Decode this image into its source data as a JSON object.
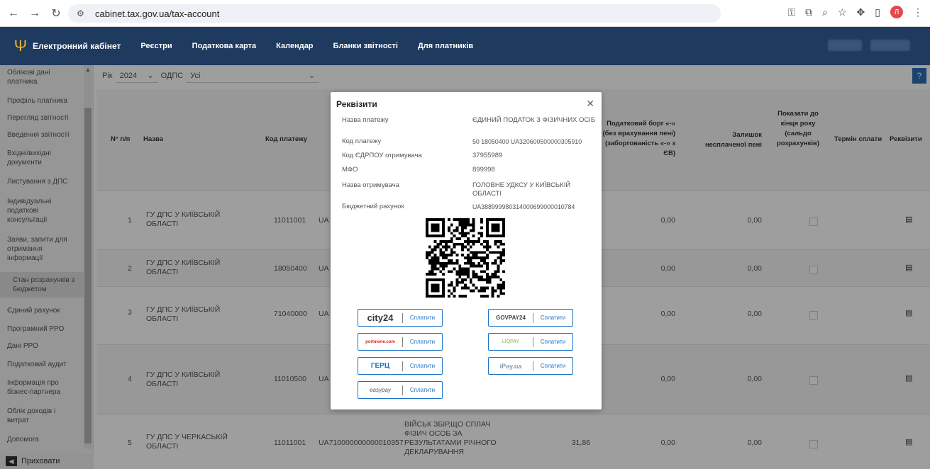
{
  "browser": {
    "url": "cabinet.tax.gov.ua/tax-account",
    "profile_initial": "Л"
  },
  "header": {
    "brand": "Електронний кабінет",
    "menu": [
      "Реєстри",
      "Податкова карта",
      "Календар",
      "Бланки звітності",
      "Для платників"
    ]
  },
  "sidebar": {
    "items": [
      "Облікові дані платника",
      "Профіль платника",
      "Перегляд звітності",
      "Введення звітності",
      "Вхідні/вихідні документи",
      "Листування з ДПС",
      "Індивідуальні податкові консультації",
      "Заяви, запити для отримання інформації",
      "Стан розрахунків з бюджетом",
      "Єдиний рахунок",
      "Програмний РРО",
      "Дані РРО",
      "Податковий аудит",
      "Інформація про бізнес-партнера",
      "Облік доходів і витрат",
      "Допомога"
    ],
    "hide_label": "Приховати"
  },
  "filters": {
    "year_label": "Рік",
    "year_value": "2024",
    "odps_label": "ОДПС",
    "odps_value": "Усі"
  },
  "table": {
    "headers": {
      "num": "N° п/п",
      "name": "Назва",
      "code": "Код платежу",
      "debt": "Податковий борг «-» (без врахування пені) (заборгованість «-» з ЄВ)",
      "fine": "Залишок несплаченої пені",
      "show_to_end": "Показати до кінця року (сальдо розрахунків)",
      "deadline": "Термін сплати",
      "details": "Реквізити"
    },
    "rows": [
      {
        "n": "1",
        "name": "ГУ ДПС У КИЇВСЬКІЙ ОБЛАСТІ",
        "code": "11011001",
        "acct": "UA",
        "debt": "0,00",
        "fine": "0,00"
      },
      {
        "n": "2",
        "name": "ГУ ДПС У КИЇВСЬКІЙ ОБЛАСТІ",
        "code": "18050400",
        "acct": "UA",
        "debt": "0,00",
        "fine": "0,00"
      },
      {
        "n": "3",
        "name": "ГУ ДПС У КИЇВСЬКІЙ ОБЛАСТІ",
        "code": "71040000",
        "acct": "UA",
        "debt": "0,00",
        "fine": "0,00"
      },
      {
        "n": "4",
        "name": "ГУ ДПС У КИЇВСЬКІЙ ОБЛАСТІ",
        "code": "11010500",
        "acct": "UA",
        "debt": "0,00",
        "fine": "0,00"
      },
      {
        "n": "5",
        "name": "ГУ ДПС У ЧЕРКАСЬКІЙ ОБЛАСТІ",
        "code": "11011001",
        "acct": "UA710000000000010357",
        "purpose": "ВІЙСЬК ЗБІР,ЩО СПЛАЧ ФІЗИЧ ОСОБ ЗА РЕЗУЛЬТАТАМИ РІЧНОГО ДЕКЛАРУВАННЯ",
        "amount": "31,86",
        "debt": "0,00",
        "fine": "0,00"
      }
    ]
  },
  "modal": {
    "title": "Реквізити",
    "fields": [
      {
        "label": "Назва платежу",
        "value": "ЄДИНИЙ ПОДАТОК З ФІЗИЧНИХ ОСІБ"
      },
      {
        "label": "Код платежу",
        "value": "50 18050400 UA320600500000305910"
      },
      {
        "label": "Код ЄДРПОУ отримувача",
        "value": "37955989"
      },
      {
        "label": "МФО",
        "value": "899998"
      },
      {
        "label": "Назва отримувача",
        "value": "ГОЛОВНЕ УДКСУ У КИЇВСЬКІЙ ОБЛАСТІ"
      },
      {
        "label": "Бюджетний рахунок",
        "value": "UA388999980314000699000010784"
      }
    ],
    "pay_label": "Сплатити",
    "providers": [
      "city24",
      "GOVPAY24",
      "portmone.com",
      "LIQPAY",
      "ГЕРЦ",
      "iPay.ua",
      "easypay"
    ]
  }
}
